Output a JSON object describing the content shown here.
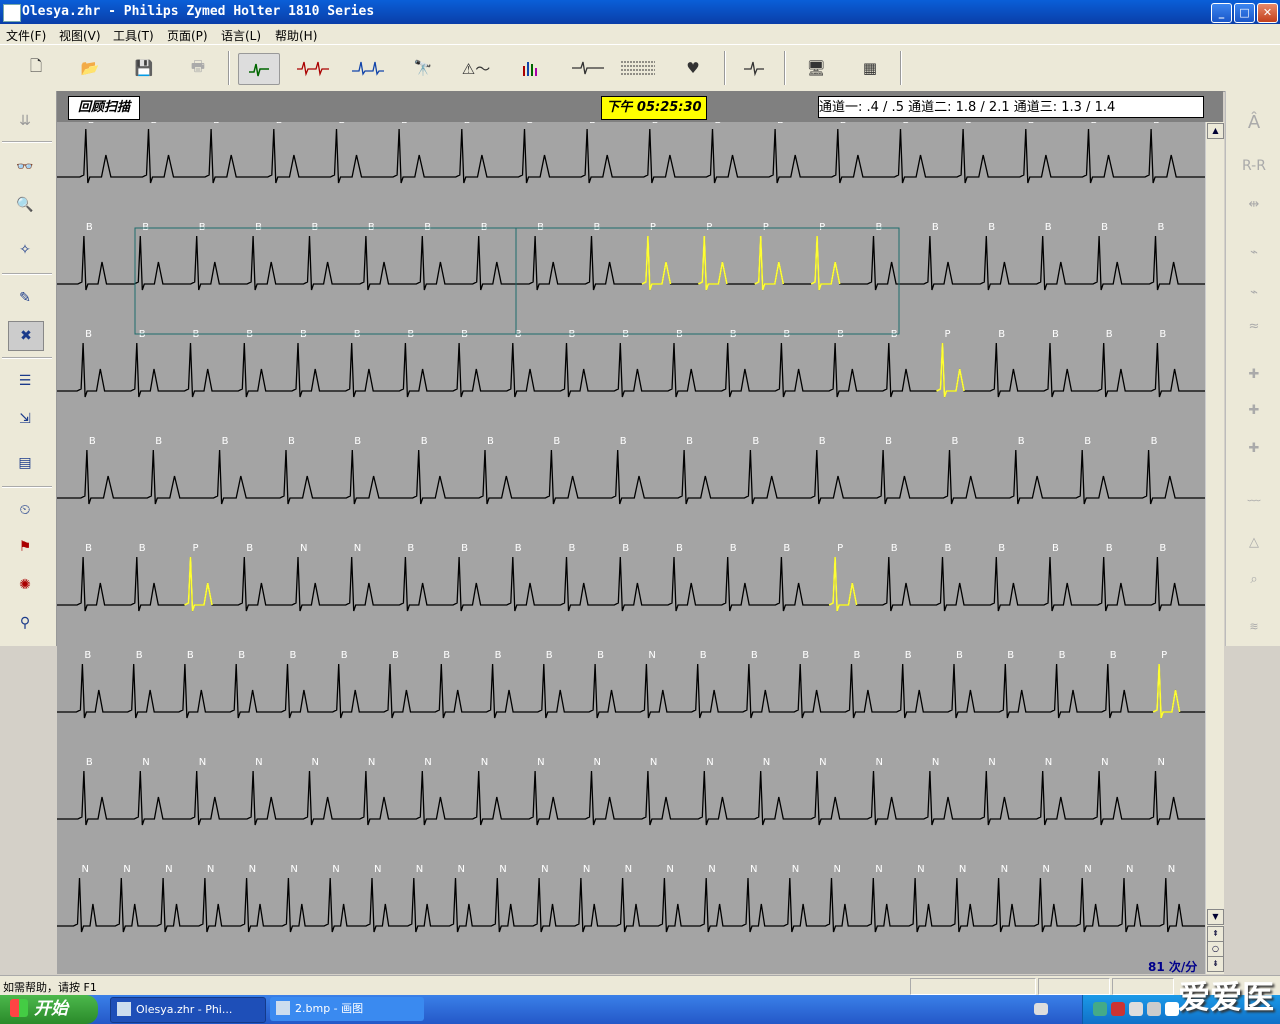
{
  "window": {
    "title": "Olesya.zhr - Philips Zymed Holter 1810 Series",
    "min": "_",
    "max": "□",
    "close": "✕"
  },
  "menu": [
    "文件(F)",
    "视图(V)",
    "工具(T)",
    "页面(P)",
    "语言(L)",
    "帮助(H)"
  ],
  "toolbar": [
    "new-doc-icon",
    "open-folder-icon",
    "save-disk-icon",
    "print-icon",
    "ecg-beat-icon",
    "rr-interval-icon",
    "strip-icon",
    "binoculars-icon",
    "warning-ecg-icon",
    "histogram-icon",
    "ecg-cross-icon",
    "full-disclosure-icon",
    "heart-hand-icon",
    "single-beat-icon",
    "monitor-icon",
    "table-icon"
  ],
  "header": {
    "mode": "回顾扫描",
    "time": "下午 05:25:30",
    "channels": "通道一:  .4  /  .5   通道二:  1.8 / 2.1   通道三:  1.3 / 1.4"
  },
  "right_toolbar": {
    "label_a": "Â",
    "label_rr": "R-R"
  },
  "ecg_rows": [
    {
      "labels": [
        {
          "t": "B"
        },
        {
          "t": "B"
        },
        {
          "t": "B"
        },
        {
          "t": "B"
        },
        {
          "t": "B"
        },
        {
          "t": "B"
        },
        {
          "t": "B"
        },
        {
          "t": "B"
        },
        {
          "t": "B"
        },
        {
          "t": "B"
        },
        {
          "t": "B"
        },
        {
          "t": "B"
        },
        {
          "t": "B"
        },
        {
          "t": "B"
        },
        {
          "t": "B"
        },
        {
          "t": "B"
        },
        {
          "t": "B"
        },
        {
          "t": "B"
        }
      ]
    },
    {
      "labels": [
        {
          "t": "B"
        },
        {
          "t": "B"
        },
        {
          "t": "B"
        },
        {
          "t": "B"
        },
        {
          "t": "B"
        },
        {
          "t": "B"
        },
        {
          "t": "B"
        },
        {
          "t": "B"
        },
        {
          "t": "B"
        },
        {
          "t": "B"
        },
        {
          "t": "P",
          "y": 1
        },
        {
          "t": "P",
          "y": 1
        },
        {
          "t": "P",
          "y": 1
        },
        {
          "t": "P",
          "y": 1
        },
        {
          "t": "B"
        },
        {
          "t": "B"
        },
        {
          "t": "B"
        },
        {
          "t": "B"
        },
        {
          "t": "B"
        },
        {
          "t": "B"
        }
      ]
    },
    {
      "labels": [
        {
          "t": "B"
        },
        {
          "t": "B"
        },
        {
          "t": "B"
        },
        {
          "t": "B"
        },
        {
          "t": "B"
        },
        {
          "t": "B"
        },
        {
          "t": "B"
        },
        {
          "t": "B"
        },
        {
          "t": "B"
        },
        {
          "t": "B"
        },
        {
          "t": "B"
        },
        {
          "t": "B"
        },
        {
          "t": "B"
        },
        {
          "t": "B"
        },
        {
          "t": "B"
        },
        {
          "t": "B"
        },
        {
          "t": "P",
          "y": 1
        },
        {
          "t": "B"
        },
        {
          "t": "B"
        },
        {
          "t": "B"
        },
        {
          "t": "B"
        }
      ]
    },
    {
      "labels": [
        {
          "t": "B"
        },
        {
          "t": "B"
        },
        {
          "t": "B"
        },
        {
          "t": "B"
        },
        {
          "t": "B"
        },
        {
          "t": "B"
        },
        {
          "t": "B"
        },
        {
          "t": "B"
        },
        {
          "t": "B"
        },
        {
          "t": "B"
        },
        {
          "t": "B"
        },
        {
          "t": "B"
        },
        {
          "t": "B"
        },
        {
          "t": "B"
        },
        {
          "t": "B"
        },
        {
          "t": "B"
        },
        {
          "t": "B"
        }
      ]
    },
    {
      "labels": [
        {
          "t": "B"
        },
        {
          "t": "B"
        },
        {
          "t": "P",
          "y": 1
        },
        {
          "t": "B"
        },
        {
          "t": "N"
        },
        {
          "t": "N"
        },
        {
          "t": "B"
        },
        {
          "t": "B"
        },
        {
          "t": "B"
        },
        {
          "t": "B"
        },
        {
          "t": "B"
        },
        {
          "t": "B"
        },
        {
          "t": "B"
        },
        {
          "t": "B"
        },
        {
          "t": "P",
          "y": 1
        },
        {
          "t": "B"
        },
        {
          "t": "B"
        },
        {
          "t": "B"
        },
        {
          "t": "B"
        },
        {
          "t": "B"
        },
        {
          "t": "B"
        }
      ]
    },
    {
      "labels": [
        {
          "t": "B"
        },
        {
          "t": "B"
        },
        {
          "t": "B"
        },
        {
          "t": "B"
        },
        {
          "t": "B"
        },
        {
          "t": "B"
        },
        {
          "t": "B"
        },
        {
          "t": "B"
        },
        {
          "t": "B"
        },
        {
          "t": "B"
        },
        {
          "t": "B"
        },
        {
          "t": "N"
        },
        {
          "t": "B"
        },
        {
          "t": "B"
        },
        {
          "t": "B"
        },
        {
          "t": "B"
        },
        {
          "t": "B"
        },
        {
          "t": "B"
        },
        {
          "t": "B"
        },
        {
          "t": "B"
        },
        {
          "t": "B"
        },
        {
          "t": "P",
          "y": 1
        }
      ]
    },
    {
      "labels": [
        {
          "t": "B"
        },
        {
          "t": "N"
        },
        {
          "t": "N"
        },
        {
          "t": "N"
        },
        {
          "t": "N"
        },
        {
          "t": "N"
        },
        {
          "t": "N"
        },
        {
          "t": "N"
        },
        {
          "t": "N"
        },
        {
          "t": "N"
        },
        {
          "t": "N"
        },
        {
          "t": "N"
        },
        {
          "t": "N"
        },
        {
          "t": "N"
        },
        {
          "t": "N"
        },
        {
          "t": "N"
        },
        {
          "t": "N"
        },
        {
          "t": "N"
        },
        {
          "t": "N"
        },
        {
          "t": "N"
        }
      ]
    },
    {
      "labels": [
        {
          "t": "N"
        },
        {
          "t": "N"
        },
        {
          "t": "N"
        },
        {
          "t": "N"
        },
        {
          "t": "N"
        },
        {
          "t": "N"
        },
        {
          "t": "N"
        },
        {
          "t": "N"
        },
        {
          "t": "N"
        },
        {
          "t": "N"
        },
        {
          "t": "N"
        },
        {
          "t": "N"
        },
        {
          "t": "N"
        },
        {
          "t": "N"
        },
        {
          "t": "N"
        },
        {
          "t": "N"
        },
        {
          "t": "N"
        },
        {
          "t": "N"
        },
        {
          "t": "N"
        },
        {
          "t": "N"
        },
        {
          "t": "N"
        },
        {
          "t": "N"
        },
        {
          "t": "N"
        },
        {
          "t": "N"
        },
        {
          "t": "N"
        },
        {
          "t": "N"
        },
        {
          "t": "N"
        }
      ]
    }
  ],
  "colors": {
    "trace": "#000000",
    "premature": "#ffff33",
    "selection": "#1e6b6b",
    "background": "#a4a4a4"
  },
  "heart_rate": "81 次/分",
  "status": {
    "help": "如需帮助，请按 F1"
  },
  "taskbar": {
    "start": "开始",
    "tasks": [
      "Olesya.zhr - Phi...",
      "2.bmp - 画图"
    ]
  },
  "watermark": "爱爱医"
}
